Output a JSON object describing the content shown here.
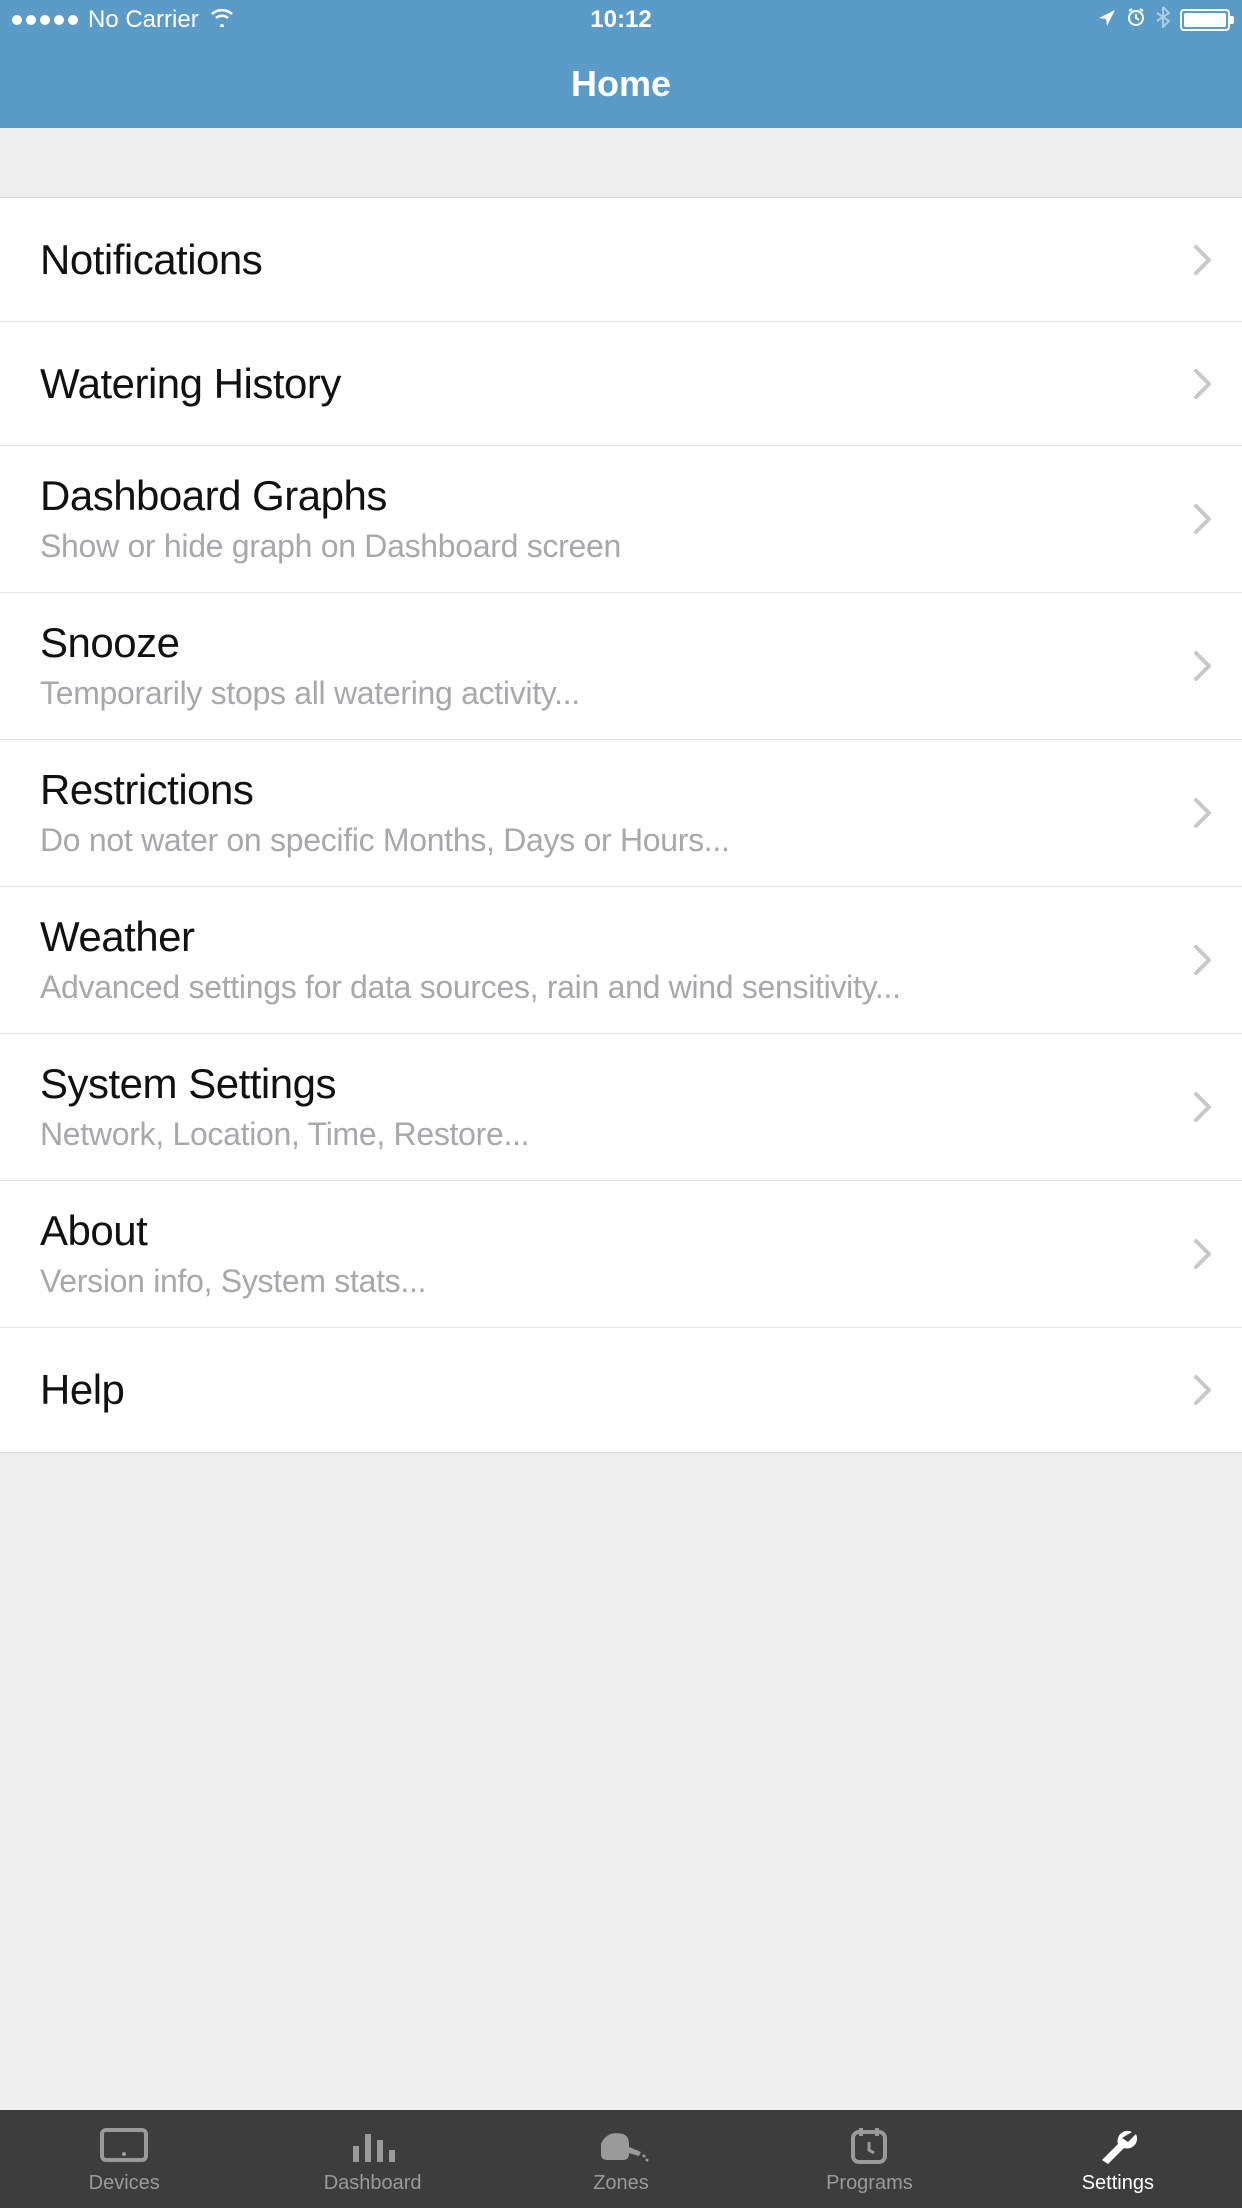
{
  "status_bar": {
    "carrier": "No Carrier",
    "time": "10:12"
  },
  "nav": {
    "title": "Home"
  },
  "settings": [
    {
      "title": "Notifications",
      "subtitle": null
    },
    {
      "title": "Watering History",
      "subtitle": null
    },
    {
      "title": "Dashboard Graphs",
      "subtitle": "Show or hide graph on Dashboard screen"
    },
    {
      "title": "Snooze",
      "subtitle": "Temporarily stops all watering activity..."
    },
    {
      "title": "Restrictions",
      "subtitle": "Do not water on specific Months, Days or Hours..."
    },
    {
      "title": "Weather",
      "subtitle": "Advanced settings for data sources, rain and wind sensitivity..."
    },
    {
      "title": "System Settings",
      "subtitle": "Network, Location, Time, Restore..."
    },
    {
      "title": "About",
      "subtitle": "Version info, System stats..."
    },
    {
      "title": "Help",
      "subtitle": null
    }
  ],
  "tabs": [
    {
      "label": "Devices"
    },
    {
      "label": "Dashboard"
    },
    {
      "label": "Zones"
    },
    {
      "label": "Programs"
    },
    {
      "label": "Settings"
    }
  ]
}
